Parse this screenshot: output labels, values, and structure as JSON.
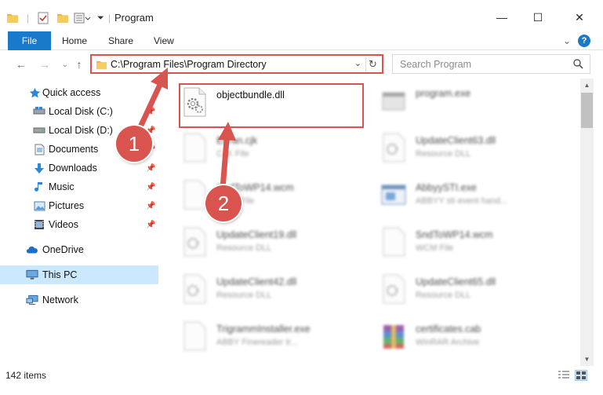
{
  "window": {
    "title": "Program",
    "minimize_glyph": "—",
    "maximize_glyph": "☐",
    "close_glyph": "✕"
  },
  "ribbon": {
    "tabs": [
      "File",
      "Home",
      "Share",
      "View"
    ],
    "expand_glyph": "⌄",
    "help_glyph": "?"
  },
  "address": {
    "path": "C:\\Program Files\\Program Directory",
    "dropdown_glyph": "⌄",
    "refresh_glyph": "↻"
  },
  "search": {
    "placeholder": "Search Program"
  },
  "nav": {
    "back_glyph": "←",
    "forward_glyph": "→",
    "recent_glyph": "⌄",
    "up_glyph": "↑",
    "items": [
      {
        "label": "Quick access",
        "icon": "star-icon",
        "pinned": false
      },
      {
        "label": "Local Disk (C:)",
        "icon": "drive-icon",
        "pinned": true
      },
      {
        "label": "Local Disk (D:)",
        "icon": "drive-icon",
        "pinned": true
      },
      {
        "label": "Documents",
        "icon": "documents-icon",
        "pinned": true
      },
      {
        "label": "Downloads",
        "icon": "downloads-icon",
        "pinned": true
      },
      {
        "label": "Music",
        "icon": "music-icon",
        "pinned": true
      },
      {
        "label": "Pictures",
        "icon": "pictures-icon",
        "pinned": true
      },
      {
        "label": "Videos",
        "icon": "videos-icon",
        "pinned": true
      },
      {
        "label": "OneDrive",
        "icon": "onedrive-icon",
        "pinned": false
      },
      {
        "label": "This PC",
        "icon": "this-pc-icon",
        "pinned": false,
        "selected": true
      },
      {
        "label": "Network",
        "icon": "network-icon",
        "pinned": false
      }
    ],
    "pin_glyph": "📌"
  },
  "files": [
    {
      "name": "objectbundle.dll",
      "desc": "",
      "icon": "dll-gear-icon",
      "highlight": true
    },
    {
      "name": "program.exe",
      "desc": "",
      "icon": "exe-icon",
      "blur": true
    },
    {
      "name": "Enran.cjk",
      "desc": "CJK File",
      "icon": "blank-file-icon",
      "blur": true
    },
    {
      "name": "UpdateClient63.dll",
      "desc": "Resource DLL",
      "icon": "dll-gear-icon",
      "blur": true
    },
    {
      "name": "SndToWP14.wcm",
      "desc": "WCM File",
      "icon": "blank-file-icon",
      "blur": true
    },
    {
      "name": "AbbyySTI.exe",
      "desc": "ABBYY sti event hand...",
      "icon": "window-exe-icon",
      "blur": true
    },
    {
      "name": "UpdateClient19.dll",
      "desc": "Resource DLL",
      "icon": "dll-gear-icon",
      "blur": true
    },
    {
      "name": "SndToWP14.wcm",
      "desc": "WCM File",
      "icon": "blank-file-icon",
      "blur": true
    },
    {
      "name": "UpdateClient42.dll",
      "desc": "Resource DLL",
      "icon": "dll-gear-icon",
      "blur": true
    },
    {
      "name": "UpdateClient65.dll",
      "desc": "Resource DLL",
      "icon": "dll-gear-icon",
      "blur": true
    },
    {
      "name": "TrigrammInstaller.exe",
      "desc": "ABBY Finereader tr...",
      "icon": "blank-file-icon",
      "blur": true
    },
    {
      "name": "certificates.cab",
      "desc": "WinRAR Archive",
      "icon": "winrar-icon",
      "blur": true
    }
  ],
  "callouts": [
    "1",
    "2"
  ],
  "status": {
    "count": "142 items"
  },
  "colors": {
    "accent": "#1979ca",
    "highlight_red": "#d9534f",
    "selected_bg": "#cce8ff"
  }
}
